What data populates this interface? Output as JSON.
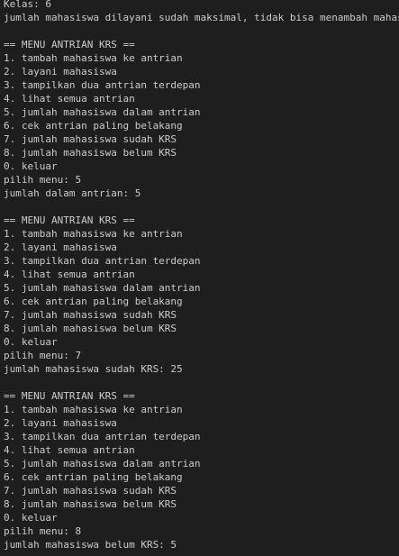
{
  "terminal": {
    "colors": {
      "background": "#1e1e1e",
      "text": "#cccccc"
    },
    "lines": [
      "Kelas: 6",
      "jumlah mahasiswa dilayani sudah maksimal, tidak bisa menambah mahasiswa",
      "",
      "== MENU ANTRIAN KRS ==",
      "1. tambah mahasiswa ke antrian",
      "2. layani mahasiswa",
      "3. tampilkan dua antrian terdepan",
      "4. lihat semua antrian",
      "5. jumlah mahasiswa dalam antrian",
      "6. cek antrian paling belakang",
      "7. jumlah mahasiswa sudah KRS",
      "8. jumlah mahasiswa belum KRS",
      "0. keluar",
      "pilih menu: 5",
      "jumlah dalam antrian: 5",
      "",
      "== MENU ANTRIAN KRS ==",
      "1. tambah mahasiswa ke antrian",
      "2. layani mahasiswa",
      "3. tampilkan dua antrian terdepan",
      "4. lihat semua antrian",
      "5. jumlah mahasiswa dalam antrian",
      "6. cek antrian paling belakang",
      "7. jumlah mahasiswa sudah KRS",
      "8. jumlah mahasiswa belum KRS",
      "0. keluar",
      "pilih menu: 7",
      "jumlah mahasiswa sudah KRS: 25",
      "",
      "== MENU ANTRIAN KRS ==",
      "1. tambah mahasiswa ke antrian",
      "2. layani mahasiswa",
      "3. tampilkan dua antrian terdepan",
      "4. lihat semua antrian",
      "5. jumlah mahasiswa dalam antrian",
      "6. cek antrian paling belakang",
      "7. jumlah mahasiswa sudah KRS",
      "8. jumlah mahasiswa belum KRS",
      "0. keluar",
      "pilih menu: 8",
      "jumlah mahasiswa belum KRS: 5"
    ]
  }
}
